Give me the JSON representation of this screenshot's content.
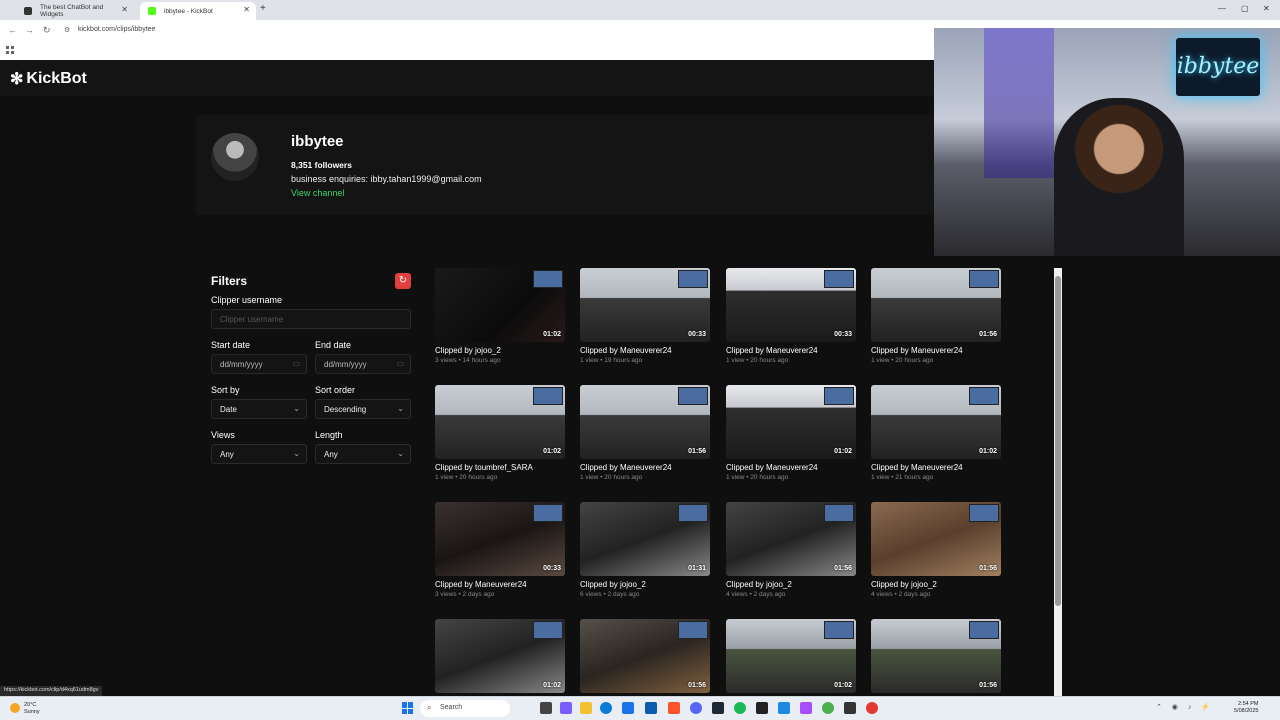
{
  "browser": {
    "tabs": [
      {
        "label": "The best ChatBot and Widgets"
      },
      {
        "label": "ibbytee - KickBot"
      }
    ],
    "new_tab": "+",
    "url": "kickbot.com/clips/ibbytee",
    "status_url": "https://kickbot.com/clip/d4xq61udm8gv"
  },
  "site": {
    "logo": "KickBot",
    "profile": {
      "name": "ibbytee",
      "followers": "8,351 followers",
      "enquiries": "business enquiries: ibby.tahan1999@gmail.com",
      "view_channel": "View channel"
    },
    "filters": {
      "title": "Filters",
      "clipper_label": "Clipper username",
      "clipper_placeholder": "Clipper username",
      "start_label": "Start date",
      "start_value": "dd/mm/yyyy",
      "end_label": "End date",
      "end_value": "dd/mm/yyyy",
      "sortby_label": "Sort by",
      "sortby_value": "Date",
      "sortorder_label": "Sort order",
      "sortorder_value": "Descending",
      "views_label": "Views",
      "views_value": "Any",
      "length_label": "Length",
      "length_value": "Any"
    },
    "clips": [
      {
        "title": "Clipped by jojoo_2",
        "meta": "3 views • 14 hours ago",
        "duration": "01:02"
      },
      {
        "title": "Clipped by Maneuverer24",
        "meta": "1 view • 19 hours ago",
        "duration": "00:33"
      },
      {
        "title": "Clipped by Maneuverer24",
        "meta": "1 view • 20 hours ago",
        "duration": "00:33"
      },
      {
        "title": "Clipped by Maneuverer24",
        "meta": "1 view • 20 hours ago",
        "duration": "01:56"
      },
      {
        "title": "Clipped by toumbref_SARA",
        "meta": "1 view • 20 hours ago",
        "duration": "01:02"
      },
      {
        "title": "Clipped by Maneuverer24",
        "meta": "1 view • 20 hours ago",
        "duration": "01:56"
      },
      {
        "title": "Clipped by Maneuverer24",
        "meta": "1 view • 20 hours ago",
        "duration": "01:02"
      },
      {
        "title": "Clipped by Maneuverer24",
        "meta": "1 view • 21 hours ago",
        "duration": "01:02"
      },
      {
        "title": "Clipped by Maneuverer24",
        "meta": "3 views • 2 days ago",
        "duration": "00:33"
      },
      {
        "title": "Clipped by jojoo_2",
        "meta": "6 views • 2 days ago",
        "duration": "01:31"
      },
      {
        "title": "Clipped by jojoo_2",
        "meta": "4 views • 2 days ago",
        "duration": "01:56"
      },
      {
        "title": "Clipped by jojoo_2",
        "meta": "4 views • 2 days ago",
        "duration": "01:56"
      },
      {
        "title": "",
        "meta": "",
        "duration": "01:02"
      },
      {
        "title": "",
        "meta": "",
        "duration": "01:56"
      },
      {
        "title": "",
        "meta": "",
        "duration": "01:02"
      },
      {
        "title": "",
        "meta": "",
        "duration": "01:56"
      }
    ],
    "webcam_neon": "ibbytee"
  },
  "taskbar": {
    "weather_temp": "20°C",
    "weather_desc": "Sunny",
    "search": "Search",
    "time": "2:54 PM",
    "date": "5/08/2025"
  }
}
